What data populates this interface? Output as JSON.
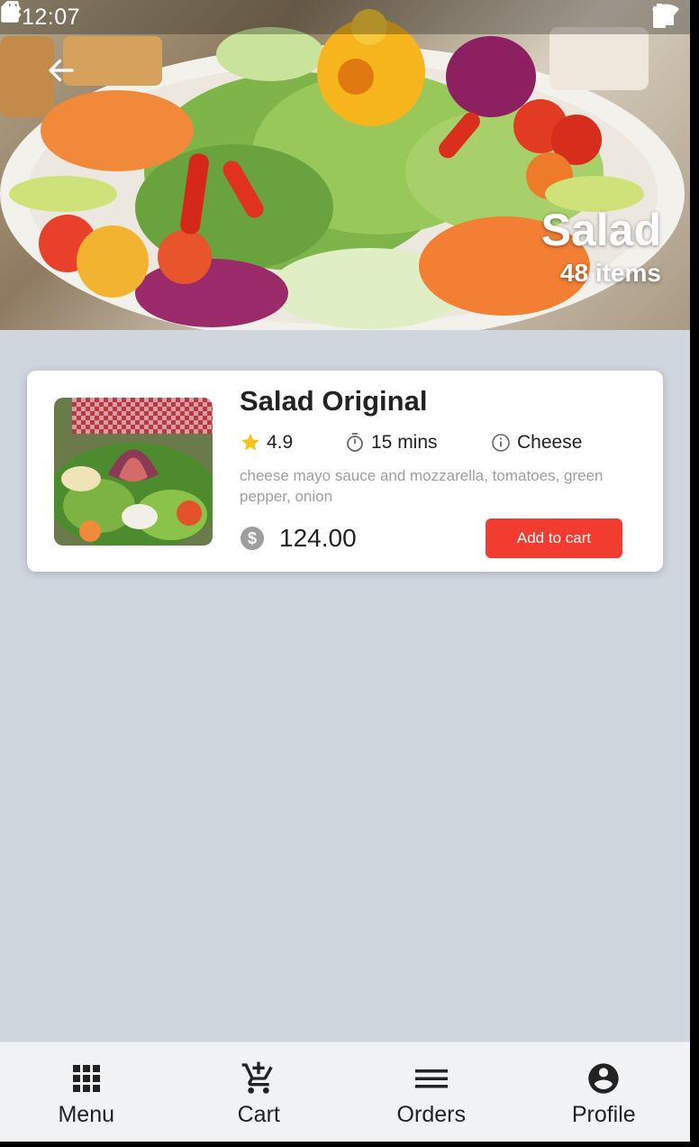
{
  "status_bar": {
    "time": "12:07"
  },
  "header": {
    "title": "Salad",
    "subtitle": "48 items"
  },
  "items": [
    {
      "name": "Salad Original",
      "rating": "4.9",
      "time": "15 mins",
      "tag": "Cheese",
      "description": "cheese mayo sauce and mozzarella, tomatoes, green pepper, onion",
      "price": "124.00",
      "add_label": "Add to cart"
    }
  ],
  "bottom_nav": {
    "items": [
      {
        "label": "Menu",
        "icon": "grid-icon"
      },
      {
        "label": "Cart",
        "icon": "add-shopping-cart-icon"
      },
      {
        "label": "Orders",
        "icon": "list-icon"
      },
      {
        "label": "Profile",
        "icon": "account-circle-icon"
      }
    ]
  },
  "colors": {
    "accent": "#f13c2f",
    "background": "#d0d6de",
    "star": "#f5c518"
  }
}
